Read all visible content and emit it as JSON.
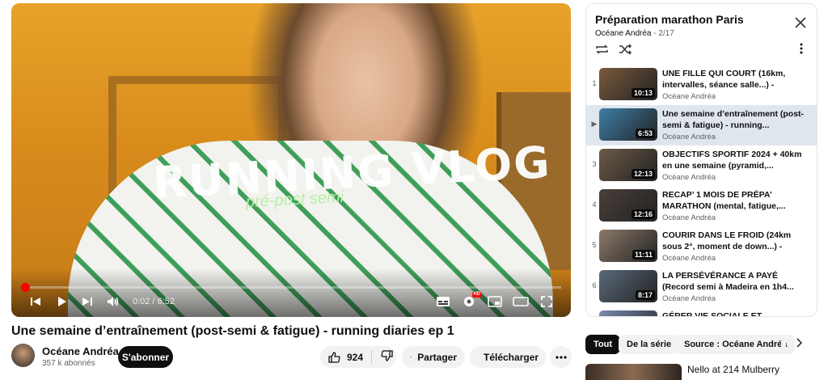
{
  "player": {
    "overlay_title": "RUNNING VLOG",
    "overlay_subtitle": "pré-post semi",
    "current_time": "0:02",
    "duration": "6:52",
    "time_display": "0:02 / 6:52",
    "progress_fraction": 0.005,
    "hd_badge": "HD",
    "icons": [
      "skip-previous-icon",
      "play-icon",
      "skip-next-icon",
      "volume-icon",
      "subtitles-icon",
      "settings-icon",
      "miniplayer-icon",
      "theater-mode-icon",
      "fullscreen-icon"
    ]
  },
  "video": {
    "title": "Une semaine d’entraînement (post-semi & fatigue) - running diaries ep 1",
    "channel": "Océane Andréa",
    "subscribers": "357 k abonnés",
    "subscribe_label": "S'abonner",
    "likes": "924",
    "share_label": "Partager",
    "download_label": "Télécharger"
  },
  "playlist": {
    "title": "Préparation marathon Paris",
    "owner": "Océane Andréa",
    "position": "- 2/17",
    "items": [
      {
        "index": "1",
        "title": "UNE FILLE QUI COURT (16km, intervalles, séance salle...) -",
        "channel": "Océane Andréa",
        "duration": "10:13",
        "thumb": "#7a5a3c"
      },
      {
        "index": "▶",
        "title": "Une semaine d’entraînement (post-semi & fatigue) - running...",
        "channel": "Océane Andréa",
        "duration": "6:53",
        "thumb": "#3f7fa8"
      },
      {
        "index": "3",
        "title": "OBJECTIFS SPORTIF 2024 + 40km en une semaine (pyramid,...",
        "channel": "Océane Andréa",
        "duration": "12:13",
        "thumb": "#6c5a48"
      },
      {
        "index": "4",
        "title": "RECAP’ 1 MOIS DE PRÉPA’ MARATHON (mental, fatigue,...",
        "channel": "Océane Andréa",
        "duration": "12:16",
        "thumb": "#4a3f3a"
      },
      {
        "index": "5",
        "title": "COURIR DANS LE FROID (24km sous 2°, moment de down...) -",
        "channel": "Océane Andréa",
        "duration": "11:11",
        "thumb": "#8c7a6a"
      },
      {
        "index": "6",
        "title": "LA PERSÉVÉRANCE A PAYÉ (Record semi à Madeira en 1h4...",
        "channel": "Océane Andréa",
        "duration": "8:17",
        "thumb": "#5a6a7a"
      },
      {
        "index": "",
        "title": "GÉRER VIE SOCIALE ET",
        "channel": "",
        "duration": "",
        "thumb": "#7a8ab0"
      }
    ]
  },
  "chips": [
    "Tout",
    "De la série",
    "Source : Océane Andréa"
  ],
  "next_video": {
    "title": "Nello at 214 Mulberry"
  }
}
